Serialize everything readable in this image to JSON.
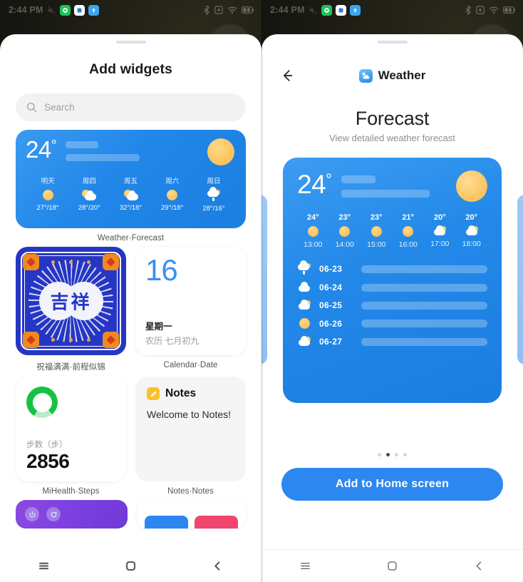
{
  "status_bar": {
    "time": "2:44 PM",
    "icons_left": [
      "mute-icon",
      "app-icon-green",
      "app-icon-blue",
      "app-icon-lightblue"
    ],
    "icons_right": [
      "bluetooth-icon",
      "alarm-icon",
      "wifi-icon",
      "battery-icon"
    ]
  },
  "left_panel": {
    "title": "Add widgets",
    "search": {
      "placeholder": "Search"
    },
    "weather_widget": {
      "temp": "24",
      "degree": "°",
      "days": [
        {
          "name": "明天",
          "icon": "sun",
          "temp": "27°/18°"
        },
        {
          "name": "周四",
          "icon": "partly-cloudy",
          "temp": "28°/20°"
        },
        {
          "name": "周五",
          "icon": "partly-cloudy",
          "temp": "32°/18°"
        },
        {
          "name": "周六",
          "icon": "sun",
          "temp": "29°/18°"
        },
        {
          "name": "周日",
          "icon": "rain",
          "temp": "28°/16°"
        }
      ],
      "label": "Weather·Forecast"
    },
    "lucky_widget": {
      "text": "吉祥",
      "label": "祝福满满·前程似锦"
    },
    "calendar_widget": {
      "day": "16",
      "weekday": "星期一",
      "lunar": "农历 七月初九",
      "label": "Calendar·Date"
    },
    "steps_widget": {
      "metric_label": "步数（步）",
      "value": "2856",
      "label": "MiHealth·Steps"
    },
    "notes_widget": {
      "title": "Notes",
      "body": "Welcome to Notes!",
      "label": "Notes·Notes"
    }
  },
  "right_panel": {
    "back_icon": "arrow-left-icon",
    "app_name": "Weather",
    "app_icon": "weather-app-icon",
    "title": "Forecast",
    "subtitle": "View detailed weather forecast",
    "preview": {
      "temp": "24",
      "degree": "°",
      "hours": [
        {
          "temp": "24°",
          "icon": "sun",
          "time": "13:00"
        },
        {
          "temp": "23°",
          "icon": "sun",
          "time": "14:00"
        },
        {
          "temp": "23°",
          "icon": "sun",
          "time": "15:00"
        },
        {
          "temp": "21°",
          "icon": "sun",
          "time": "16:00"
        },
        {
          "temp": "20°",
          "icon": "partly-cloudy",
          "time": "17:00"
        },
        {
          "temp": "20°",
          "icon": "partly-cloudy",
          "time": "18:00"
        }
      ],
      "days": [
        {
          "icon": "rain",
          "date": "06-23"
        },
        {
          "icon": "cloud",
          "date": "06-24"
        },
        {
          "icon": "partly-cloudy",
          "date": "06-25"
        },
        {
          "icon": "sun",
          "date": "06-26"
        },
        {
          "icon": "partly-cloudy",
          "date": "06-27"
        }
      ]
    },
    "pager": {
      "count": 4,
      "active_index": 1
    },
    "cta_label": "Add to Home screen"
  },
  "nav_bar": {
    "recents": "recents-icon",
    "home": "home-icon",
    "back": "back-icon"
  },
  "colors": {
    "accent": "#2d87f0",
    "widget_blue": "#2389e9",
    "lucky_blue": "#2636c4",
    "steps_green": "#16c244",
    "notes_yellow": "#fbc02d"
  }
}
